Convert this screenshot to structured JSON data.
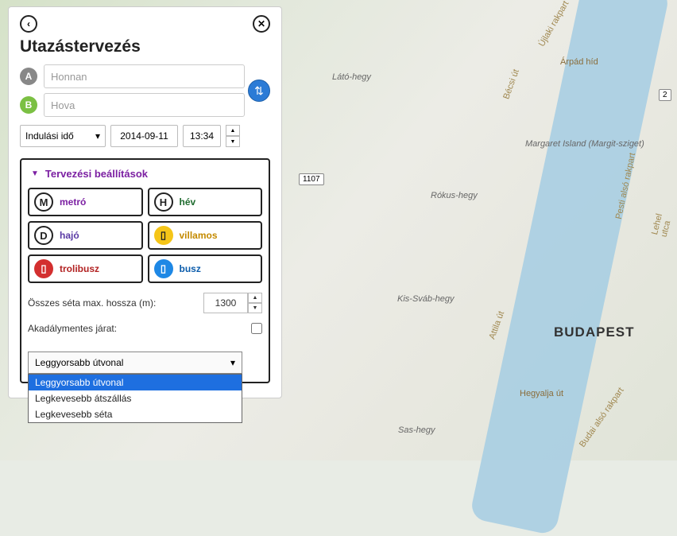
{
  "title": "Utazástervezés",
  "from": {
    "placeholder": "Honnan",
    "value": ""
  },
  "to": {
    "placeholder": "Hova",
    "value": ""
  },
  "timeType": "Indulási idő",
  "date": "2014-09-11",
  "time": "13:34",
  "settingsHeader": "Tervezési beállítások",
  "modes": {
    "metro": "metró",
    "hev": "hév",
    "hajo": "hajó",
    "villamos": "villamos",
    "trolibusz": "trolibusz",
    "busz": "busz"
  },
  "walkLabel": "Összes séta max. hossza (m):",
  "walkValue": "1300",
  "accessibleLabel": "Akadálymentes járat:",
  "accessibleChecked": false,
  "optimizeSelected": "Leggyorsabb útvonal",
  "optimizeOptions": [
    "Leggyorsabb útvonal",
    "Legkevesebb átszállás",
    "Legkevesebb séta"
  ],
  "map": {
    "cityLabel": "BUDAPEST",
    "places": {
      "latoHegy": "Látó-hegy",
      "rokusHegy": "Rókus-hegy",
      "kisSvab": "Kis-Sváb-hegy",
      "sasHegy": "Sas-hegy",
      "margit": "Margaret Island (Margit-sziget)",
      "arpadHid": "Árpád híd",
      "hegyaljaUt": "Hegyalja út",
      "attilaUt": "Attila út",
      "budaiUt": "Budai alsó rakpart",
      "becsiUt": "Bécsi út",
      "ujlakiRakpart": "Újlaki rakpart",
      "lehelUtca": "Lehel utca",
      "pestiRakpart": "Pesti alsó rakpart"
    },
    "shields": {
      "r2": "2",
      "r1107": "1107"
    }
  }
}
